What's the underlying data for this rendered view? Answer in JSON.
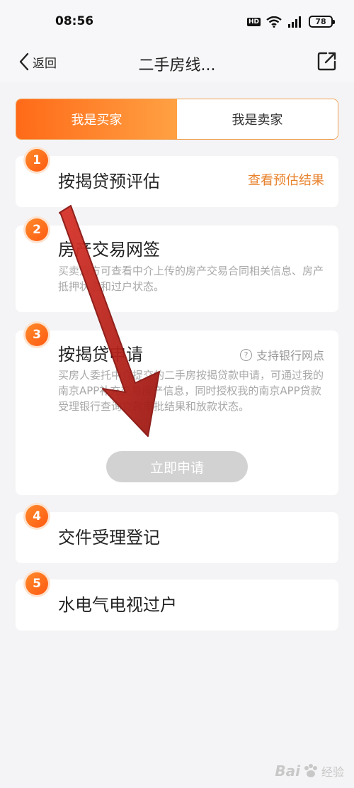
{
  "status_bar": {
    "time": "08:56",
    "hd_badge": "HD",
    "battery": "78"
  },
  "nav": {
    "back_label": "返回",
    "title": "二手房线..."
  },
  "tabs": [
    {
      "label": "我是买家",
      "active": true
    },
    {
      "label": "我是卖家",
      "active": false
    }
  ],
  "steps": [
    {
      "number": "1",
      "title": "按揭贷预评估",
      "link": "查看预估结果"
    },
    {
      "number": "2",
      "title": "房产交易网签",
      "desc": "买卖双方可查看中介上传的房产交易合同相关信息、房产抵押状态和过户状态。"
    },
    {
      "number": "3",
      "title": "按揭贷申请",
      "help": "支持银行网点",
      "desc": "买房人委托中介提交的二手房按揭贷款申请，可通过我的南京APP补充交易房产信息，同时授权我的南京APP贷款受理银行查询贷款审批结果和放款状态。",
      "button": "立即申请"
    },
    {
      "number": "4",
      "title": "交件受理登记"
    },
    {
      "number": "5",
      "title": "水电气电视过户"
    }
  ],
  "watermark": {
    "brand": "Bai",
    "sub": "经验"
  },
  "colors": {
    "accent": "#ff6a18",
    "accent_light": "#ffa143",
    "link": "#e8822c",
    "arrow": "#c0231c"
  }
}
